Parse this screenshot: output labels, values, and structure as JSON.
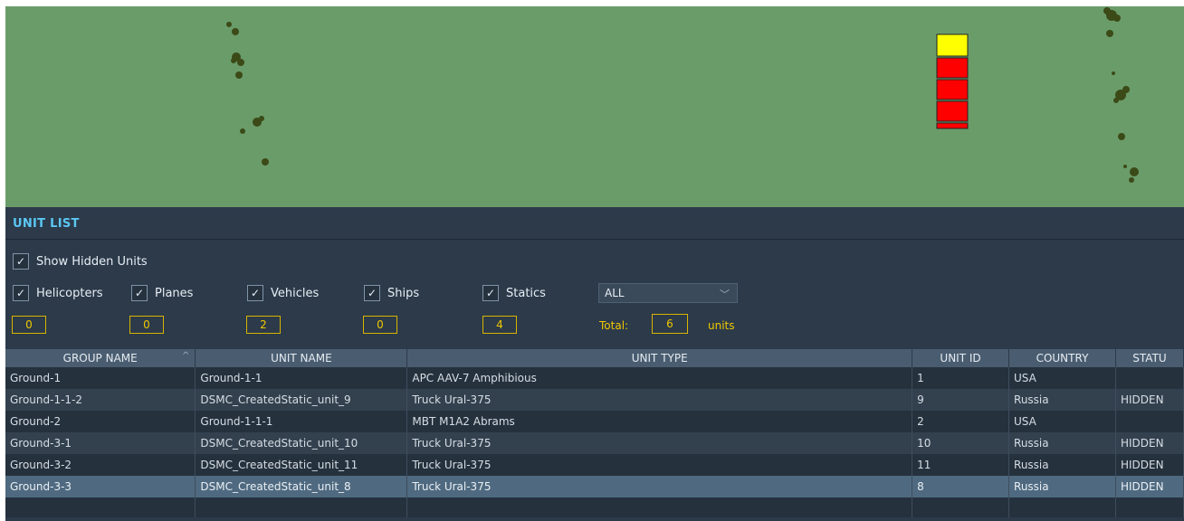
{
  "panel": {
    "title": "UNIT LIST"
  },
  "show_hidden": {
    "label": "Show Hidden Units",
    "checked": true
  },
  "filters": [
    {
      "label": "Helicopters",
      "checked": true,
      "count": "0"
    },
    {
      "label": "Planes",
      "checked": true,
      "count": "0"
    },
    {
      "label": "Vehicles",
      "checked": true,
      "count": "2"
    },
    {
      "label": "Ships",
      "checked": true,
      "count": "0"
    },
    {
      "label": "Statics",
      "checked": true,
      "count": "4"
    }
  ],
  "coalition_select": {
    "value": "ALL"
  },
  "total": {
    "label": "Total:",
    "value": "6",
    "units": "units"
  },
  "table": {
    "columns": [
      "GROUP NAME",
      "UNIT NAME",
      "UNIT TYPE",
      "UNIT ID",
      "COUNTRY",
      "STATU"
    ],
    "rows": [
      [
        "Ground-1",
        "Ground-1-1",
        "APC AAV-7 Amphibious",
        "1",
        "USA",
        ""
      ],
      [
        "Ground-1-1-2",
        "DSMC_CreatedStatic_unit_9",
        "Truck Ural-375",
        "9",
        "Russia",
        "HIDDEN"
      ],
      [
        "Ground-2",
        "Ground-1-1-1",
        "MBT M1A2 Abrams",
        "2",
        "USA",
        ""
      ],
      [
        "Ground-3-1",
        "DSMC_CreatedStatic_unit_10",
        "Truck Ural-375",
        "10",
        "Russia",
        "HIDDEN"
      ],
      [
        "Ground-3-2",
        "DSMC_CreatedStatic_unit_11",
        "Truck Ural-375",
        "11",
        "Russia",
        "HIDDEN"
      ],
      [
        "Ground-3-3",
        "DSMC_CreatedStatic_unit_8",
        "Truck Ural-375",
        "8",
        "Russia",
        "HIDDEN"
      ]
    ],
    "selected_row": 5
  },
  "colors": {
    "map": "#6a9c6a",
    "panel": "#2c3a4a",
    "title": "#5bc7f2",
    "count": "#f0c800",
    "red_units": "#ff0000",
    "yellow_unit": "#ffff00"
  }
}
